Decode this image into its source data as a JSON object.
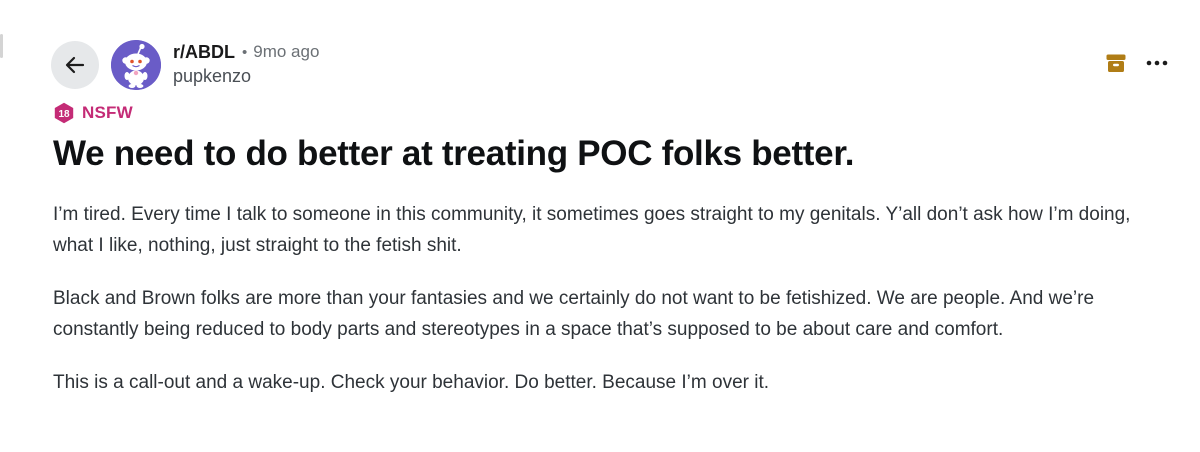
{
  "post": {
    "subreddit": "r/ABDL",
    "separator": "•",
    "time_ago": "9mo ago",
    "author": "pupkenzo",
    "nsfw_badge": "18",
    "nsfw_label": "NSFW",
    "title": "We need to do better at treating POC folks better.",
    "paragraphs": [
      "I’m tired. Every time I talk to someone in this community, it sometimes goes straight to my genitals. Y’all don’t ask how I’m doing, what I like, nothing, just straight to the fetish shit.",
      "Black and Brown folks are more than your fantasies and we certainly do not want to be fetishized. We are people. And we’re constantly being reduced to body parts and stereotypes in a space that’s supposed to be about care and comfort.",
      "This is a call-out and a wake-up. Check your behavior. Do better. Because I’m over it."
    ]
  },
  "icons": {
    "back": "arrow-left-icon",
    "avatar": "snoo-avatar-icon",
    "archive": "archive-icon",
    "more": "more-horizontal-icon",
    "nsfw": "nsfw-18-icon"
  },
  "colors": {
    "nsfw": "#c42b76",
    "archive": "#b07d16",
    "avatar_bg": "#6a5cc7",
    "back_button_bg": "#e6e8ea"
  }
}
